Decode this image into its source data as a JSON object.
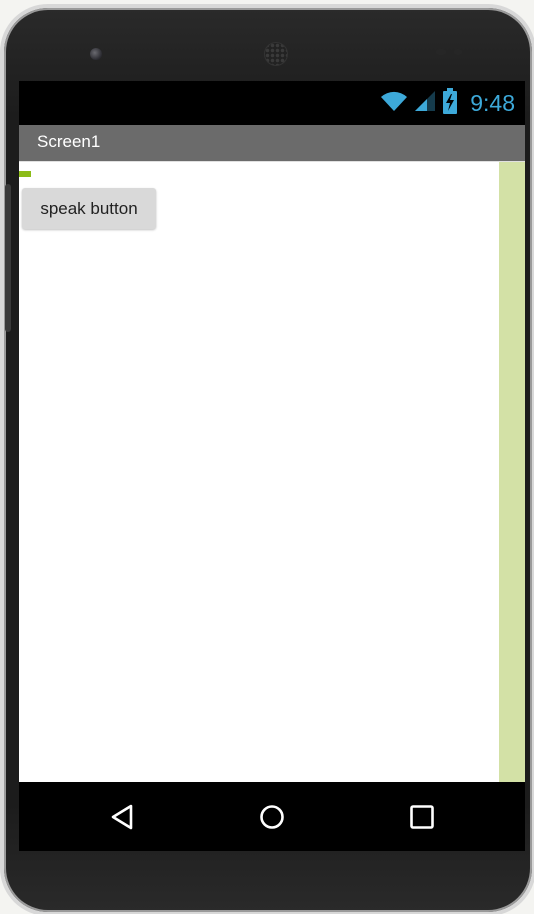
{
  "status_bar": {
    "time": "9:48",
    "icons": [
      "wifi-icon",
      "signal-icon",
      "battery-charging-icon"
    ],
    "time_color": "#3da9d9"
  },
  "app_bar": {
    "title": "Screen1",
    "background": "#6b6b6b"
  },
  "content": {
    "speak_button_label": "speak button",
    "right_strip_color": "#d3e1a6",
    "marker_color": "#8cbc18"
  },
  "nav_bar": {
    "buttons": [
      "back-icon",
      "home-icon",
      "recents-icon"
    ]
  }
}
